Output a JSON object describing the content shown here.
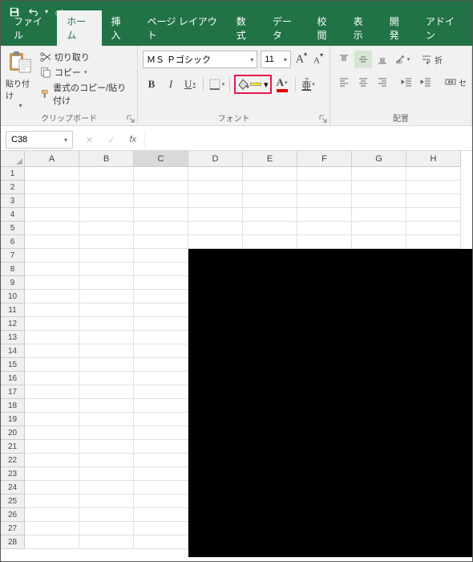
{
  "titlebar": {
    "save": "save",
    "undo": "undo",
    "redo": "redo",
    "customize": "customize"
  },
  "tabs": [
    "ファイル",
    "ホーム",
    "挿入",
    "ページ レイアウト",
    "数式",
    "データ",
    "校閲",
    "表示",
    "開発",
    "アドイン"
  ],
  "activeTab": 1,
  "clipboard": {
    "paste": "貼り付け",
    "cut": "切り取り",
    "copy": "コピー",
    "formatPainter": "書式のコピー/貼り付け",
    "groupLabel": "クリップボード"
  },
  "font": {
    "name": "ＭＳ Ｐゴシック",
    "size": "11",
    "groupLabel": "フォント"
  },
  "align": {
    "wrap": "折",
    "merge": "セ",
    "groupLabel": "配置"
  },
  "namebox": "C38",
  "cols": [
    "A",
    "B",
    "C",
    "D",
    "E",
    "F",
    "G",
    "H"
  ],
  "rowCount": 28,
  "selectedCol": 2,
  "blackbox": {
    "startCol": 3,
    "startRow": 7
  }
}
